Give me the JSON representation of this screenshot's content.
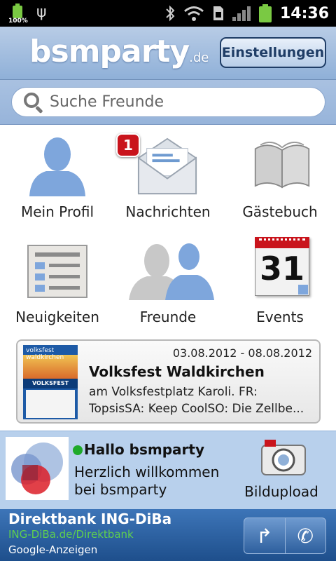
{
  "status_bar": {
    "battery_small_percent": "100%",
    "time": "14:36",
    "icons": [
      "battery-icon",
      "usb-icon",
      "bluetooth-icon",
      "wifi-icon",
      "sim-icon",
      "signal-icon",
      "battery-icon"
    ]
  },
  "header": {
    "logo_text": "bsmparty",
    "logo_tld": ".de",
    "settings_label": "Einstellungen"
  },
  "search": {
    "placeholder": "Suche Freunde"
  },
  "menu": [
    {
      "label": "Mein Profil",
      "icon": "profile-icon"
    },
    {
      "label": "Nachrichten",
      "icon": "envelope-icon",
      "badge": "1"
    },
    {
      "label": "Gästebuch",
      "icon": "book-icon"
    },
    {
      "label": "Neuigkeiten",
      "icon": "news-icon"
    },
    {
      "label": "Freunde",
      "icon": "friends-icon"
    },
    {
      "label": "Events",
      "icon": "calendar-icon",
      "calendar_day": "31"
    }
  ],
  "event": {
    "date_range": "03.08.2012 - 08.08.2012",
    "title": "Volksfest Waldkirchen",
    "desc_line1": "am Volksfestplatz Karoli. FR:",
    "desc_line2": "TopsisSA: Keep CoolSO: Die Zellbe...",
    "thumb_header": "volksfest waldkirchen",
    "thumb_band": "VOLKSFEST"
  },
  "welcome": {
    "greeting": "Hallo bsmparty",
    "message_line1": "Herzlich willkommen",
    "message_line2": "bei bsmparty",
    "upload_label": "Bildupload"
  },
  "ad": {
    "title": "Direktbank ING-DiBa",
    "url": "ING-DiBa.de/Direktbank",
    "source": "Google-Anzeigen",
    "arrow": "↱",
    "phone": "✆"
  },
  "colors": {
    "header_blue": "#8fb0d8",
    "badge_red": "#c9141c",
    "online_green": "#1faa2a",
    "ad_blue": "#1e4f8c",
    "ad_url_green": "#5fcf4f"
  }
}
